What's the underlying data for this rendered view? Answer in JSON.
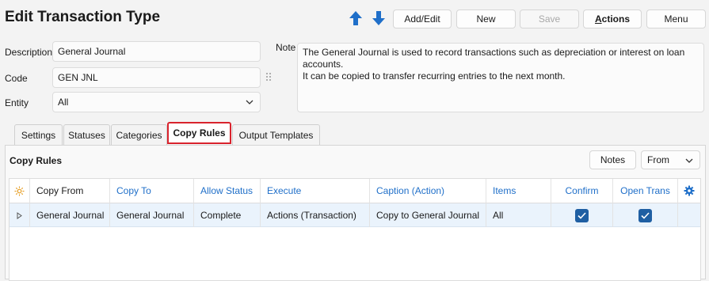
{
  "header": {
    "title": "Edit Transaction Type",
    "buttons": {
      "add_edit": "Add/Edit",
      "new": "New",
      "save": "Save",
      "actions_first": "A",
      "actions_rest": "ctions",
      "menu": "Menu"
    }
  },
  "form": {
    "description_label": "Description",
    "description_value": "General Journal",
    "code_label": "Code",
    "code_value": "GEN JNL",
    "entity_label": "Entity",
    "entity_value": "All",
    "note_label": "Note",
    "note_line1": "The General Journal is used to record transactions such as depreciation or interest on loan accounts.",
    "note_line2": "It can be copied to transfer recurring entries to the next month."
  },
  "tabs": [
    "Settings",
    "Statuses",
    "Categories",
    "Copy Rules",
    "Output Templates"
  ],
  "active_tab": "Copy Rules",
  "copy_rules": {
    "section_title": "Copy Rules",
    "notes_button": "Notes",
    "from_select": "From",
    "columns": [
      "Copy From",
      "Copy To",
      "Allow Status",
      "Execute",
      "Caption (Action)",
      "Items",
      "Confirm",
      "Open Trans"
    ],
    "rows": [
      {
        "copy_from": "General Journal",
        "copy_to": "General Journal",
        "allow_status": "Complete",
        "execute": "Actions (Transaction)",
        "caption": "Copy to General Journal",
        "items": "All",
        "confirm": true,
        "open_trans": true
      }
    ]
  },
  "colors": {
    "accent_blue": "#1f6fc9",
    "checkbox_blue": "#1f5fa3",
    "active_tab_border": "#d9232d",
    "row_highlight": "#eaf3fc"
  },
  "icons": {
    "move_up": "arrow-up-icon",
    "move_down": "arrow-down-icon",
    "row_expand": "triangle-right-icon",
    "column_settings": "gear-icon",
    "new_row": "sun-icon",
    "drag_handle": "grip-icon"
  }
}
